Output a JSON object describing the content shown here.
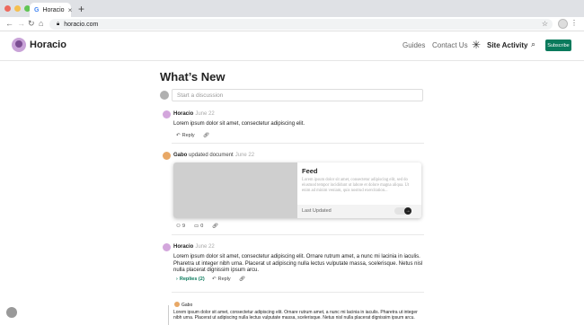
{
  "browser": {
    "tab_title": "Horacio",
    "tab_favicon": "G",
    "url": "horacio.com",
    "colors": {
      "red": "#ed6a5e",
      "yellow": "#f5bf4f",
      "green": "#61c554"
    }
  },
  "header": {
    "brand": "Horacio",
    "nav": [
      "Guides",
      "Contact Us"
    ],
    "site_activity": "Site Activity",
    "subscribe": "Subscribe",
    "accent": "#0a7a5c"
  },
  "page": {
    "title": "What’s New",
    "discussion_placeholder": "Start a discussion"
  },
  "posts": [
    {
      "author": "Horacio",
      "date": "June 22",
      "body": "Lorem ipsum dolor sit amet, consectetur adipiscing elit.",
      "reply_label": "Reply"
    },
    {
      "author": "Gabo",
      "action": "updated document",
      "date": "June 22",
      "card": {
        "title": "Feed",
        "desc": "Lorem ipsum dolor sit amet, consectetur adipiscing elit, sed do eiusmod tempor incididunt ut labore et dolore magna aliqua. Ut enim ad minim veniam, quis nostrud exercitation...",
        "footer": "Last Updated"
      },
      "likes": "9",
      "comments": "0"
    },
    {
      "author": "Horacio",
      "date": "June 22",
      "body": "Lorem ipsum dolor sit amet, consectetur adipiscing elit. Ornare rutrum amet, a nunc mi lacinia in iaculis. Pharetra ut integer nibh urna. Placerat ut adipiscing nulla lectus vulputate massa, scelerisque. Netus nisl nulla placerat dignissim ipsum arcu.",
      "replies_label": "Replies (2)",
      "reply_label": "Reply"
    }
  ],
  "nested_reply": {
    "author": "Gabo",
    "body": "Lorem ipsum dolor sit amet, consectetur adipiscing elit. Ornare rutrum amet, a nunc mi lacinia in iaculis. Pharetra ut integer nibh urna. Placerat ut adipiscing nulla lectus vulputate massa, scelerisque. Netus nisl nulla placerat dignissim ipsum arcu."
  }
}
